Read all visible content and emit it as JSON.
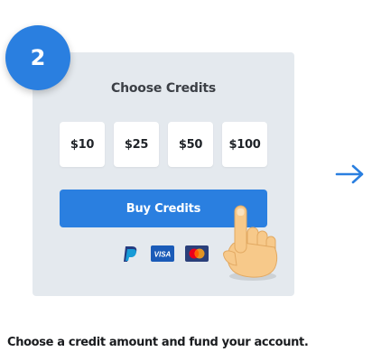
{
  "step": {
    "number": "2"
  },
  "card": {
    "title": "Choose Credits",
    "amounts": [
      "$10",
      "$25",
      "$50",
      "$100"
    ],
    "buy_button_label": "Buy Credits",
    "payment_methods": [
      "paypal-icon",
      "visa-icon",
      "mastercard-icon"
    ]
  },
  "caption": "Choose a credit amount and fund your account.",
  "colors": {
    "accent": "#2a7fe0",
    "card_background": "#e4e9ee",
    "button_text": "#ffffff"
  },
  "icons": {
    "pointer": "hand-pointer-icon",
    "next": "arrow-right-icon"
  }
}
